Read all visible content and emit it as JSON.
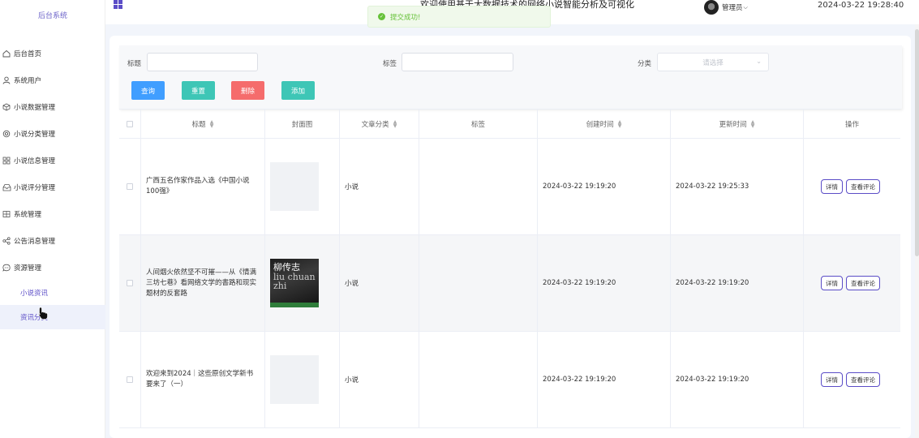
{
  "sidebar": {
    "brand": "后台系统",
    "items": [
      {
        "label": "后台首页",
        "icon": "home-icon"
      },
      {
        "label": "系统用户",
        "icon": "user-icon"
      },
      {
        "label": "小说数据管理",
        "icon": "cube-icon"
      },
      {
        "label": "小说分类管理",
        "icon": "target-icon"
      },
      {
        "label": "小说信息管理",
        "icon": "apps-icon"
      },
      {
        "label": "小说评分管理",
        "icon": "inbox-icon"
      },
      {
        "label": "系统管理",
        "icon": "grid-table-icon"
      },
      {
        "label": "公告消息管理",
        "icon": "share-icon"
      },
      {
        "label": "资源管理",
        "icon": "chat-icon"
      }
    ],
    "subitems": [
      {
        "label": "小说资讯"
      },
      {
        "label": "资讯分类"
      }
    ]
  },
  "header": {
    "title": "欢迎使用基于大数据技术的网络小说智能分析及可视化",
    "user": "管理员",
    "datetime": "2024-03-22 19:28:40"
  },
  "toast": {
    "message": "提交成功!"
  },
  "filters": {
    "title_label": "标题",
    "tag_label": "标签",
    "category_label": "分类",
    "category_placeholder": "请选择",
    "buttons": {
      "query": "查询",
      "reset": "重置",
      "delete": "删除",
      "add": "添加"
    }
  },
  "table": {
    "columns": {
      "title": "标题",
      "cover": "封面图",
      "category": "文章分类",
      "tags": "标签",
      "created": "创建时间",
      "updated": "更新时间",
      "actions": "操作"
    },
    "rows": [
      {
        "title": "广西五名作家作品入选《中国小说100强》",
        "category": "小说",
        "tags": "",
        "created": "2024-03-22 19:19:20",
        "updated": "2024-03-22 19:25:33",
        "cover_text": "",
        "cover_latin": ""
      },
      {
        "title": "人间烟火依然坚不可摧——从《情满三坊七巷》看网络文学的書路和现实题材的反套路",
        "category": "小说",
        "tags": "",
        "created": "2024-03-22 19:19:20",
        "updated": "2024-03-22 19:19:20",
        "cover_text": "柳传志",
        "cover_latin": "liu chuan zhi"
      },
      {
        "title": "欢迎来到2024｜这些原创文学新书要来了（一）",
        "category": "小说",
        "tags": "",
        "created": "2024-03-22 19:19:20",
        "updated": "2024-03-22 19:19:20",
        "cover_text": "",
        "cover_latin": ""
      }
    ],
    "row_actions": {
      "detail": "详情",
      "comments": "查看评论"
    }
  },
  "colors": {
    "accent": "#5b4dc7",
    "query": "#409eff",
    "reset": "#3ec6b6",
    "delete": "#f56c6c",
    "add": "#3ec6b6",
    "success": "#67c23a"
  }
}
